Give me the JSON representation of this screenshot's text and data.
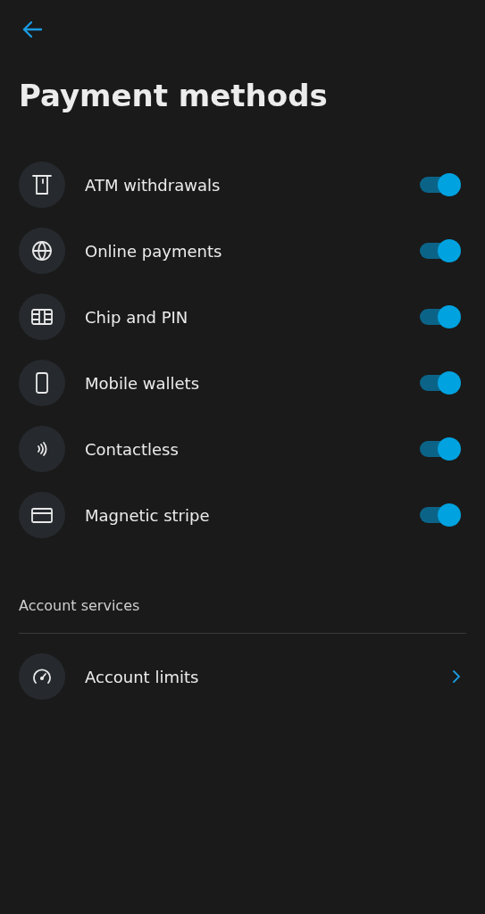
{
  "title": "Payment methods",
  "methods": [
    {
      "kind": "atm",
      "label": "ATM withdrawals",
      "on": true
    },
    {
      "kind": "globe",
      "label": "Online payments",
      "on": true
    },
    {
      "kind": "chip",
      "label": "Chip and PIN",
      "on": true
    },
    {
      "kind": "phone",
      "label": "Mobile wallets",
      "on": true
    },
    {
      "kind": "contactless",
      "label": "Contactless",
      "on": true
    },
    {
      "kind": "card",
      "label": "Magnetic stripe",
      "on": true
    }
  ],
  "section": {
    "title": "Account services",
    "items": [
      {
        "kind": "gauge",
        "label": "Account limits"
      }
    ]
  }
}
